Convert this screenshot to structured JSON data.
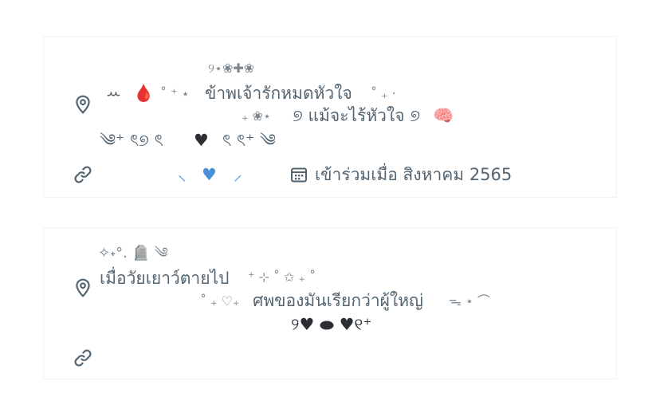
{
  "profile_a": {
    "location": {
      "deco_top": "୨⋆❀✚❀",
      "line1_prefix": "ꕀ",
      "line1_blood": "🩸",
      "line1_mid": "˚ ⁺ ⋆",
      "line1_text": "ข้าพเจ้ารักหมดหัวใจ",
      "line1_suffix": "˚ ₊ ‧",
      "line2_prefix": "₊ ❀⋆",
      "line2_text": "୭ แม้จะไร้หัวใจ ୭",
      "line2_brain": "🧠",
      "line3_left": "༄⁺ ৎ୭ ৎ",
      "line3_heart": "♥",
      "line3_right": "ৎ ৎ⁺ ༄"
    },
    "website": {
      "wing_left": "⸜",
      "heart": "♥",
      "wing_right": "⸝"
    },
    "joined": "เข้าร่วมเมื่อ สิงหาคม 2565"
  },
  "profile_b": {
    "location": {
      "deco_top": "✧˖°. 🪦 ༄",
      "line1_text": "เมื่อวัยเยาว์ตายไป",
      "line1_suffix": "⁺ ⊹ ˚ ✩ ₊ ˚",
      "line2_prefix": "˚ ₊ ♡₊",
      "line2_text": "ศพของมันเรียกว่าผู้ใหญ่",
      "line2_suffix": "ᯓ ⋆ ⌒",
      "line3": "୨♥ ⬬ ♥୧⁺"
    }
  },
  "icons": {
    "location": "map-pin-icon",
    "website": "link-icon",
    "calendar": "calendar-icon"
  },
  "colors": {
    "text": "#536471",
    "border": "#eff3f4",
    "blood": "#c8102e",
    "heart_blue": "#4a90d9"
  }
}
